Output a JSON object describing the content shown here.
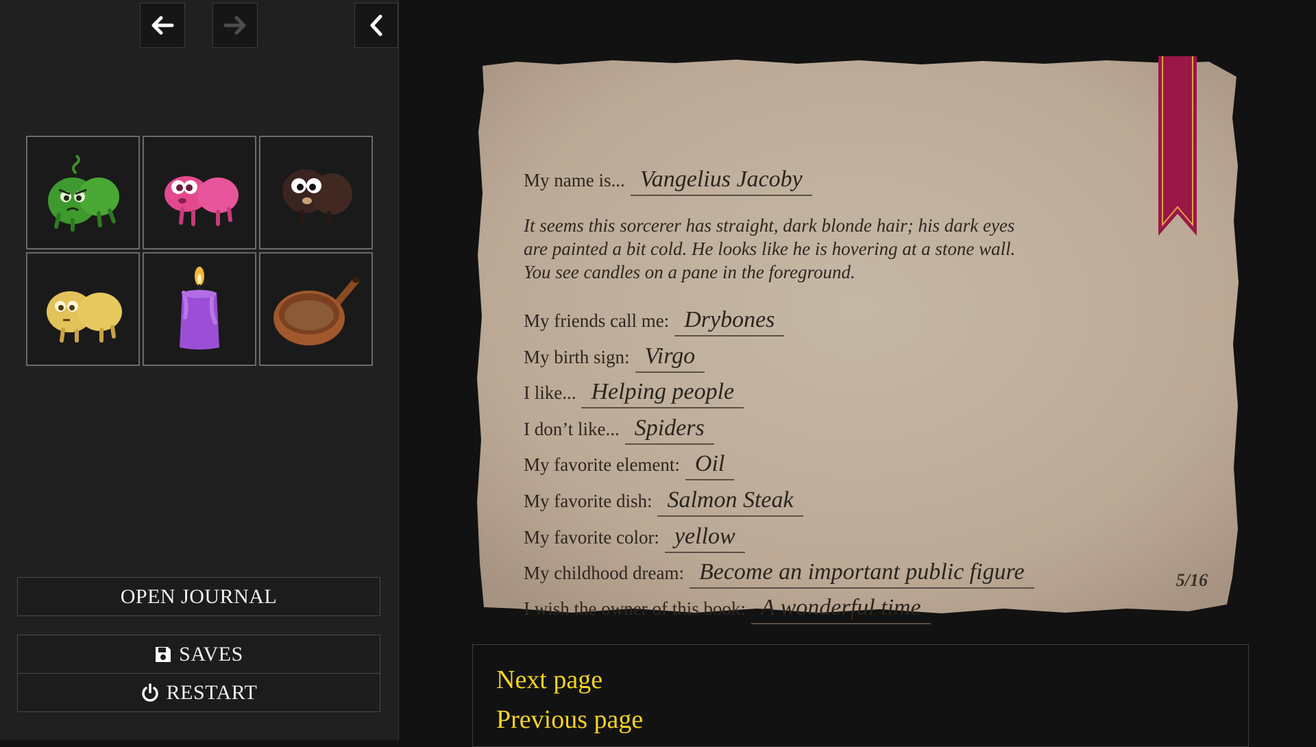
{
  "sidebar": {
    "nav": {
      "back_icon": "arrow-left-icon",
      "forward_icon": "arrow-right-icon",
      "collapse_icon": "chevron-left-icon"
    },
    "inventory": [
      {
        "item": "green-bean-creature-icon"
      },
      {
        "item": "pink-bean-creature-icon"
      },
      {
        "item": "black-bean-creature-icon"
      },
      {
        "item": "yellow-bean-creature-icon"
      },
      {
        "item": "purple-candle-icon"
      },
      {
        "item": "copper-pan-icon"
      }
    ],
    "open_journal_label": "OPEN JOURNAL",
    "saves_label": "SAVES",
    "restart_label": "RESTART"
  },
  "journal": {
    "name_label": "My name is...",
    "name_value": "Vangelius Jacoby",
    "description_lines": [
      "It seems this sorcerer has straight, dark blonde hair; his dark eyes",
      "are painted a bit cold. He looks like he is hovering at a stone wall.",
      "You see candles on a pane in the foreground."
    ],
    "fields": [
      {
        "label": "My friends call me:",
        "value": "Drybones"
      },
      {
        "label": "My birth sign:",
        "value": "Virgo"
      },
      {
        "label": "I like...",
        "value": "Helping people"
      },
      {
        "label": "I don’t like...",
        "value": "Spiders"
      },
      {
        "label": "My favorite element:",
        "value": "Oil"
      },
      {
        "label": "My favorite dish:",
        "value": "Salmon Steak"
      },
      {
        "label": "My favorite color:",
        "value": "yellow"
      },
      {
        "label": "My childhood dream:",
        "value": "Become an important public figure"
      },
      {
        "label": "I wish the owner of this book:",
        "value": "A wonderful time"
      }
    ],
    "page_indicator": "5/16"
  },
  "choices": {
    "next_label": "Next page",
    "previous_label": "Previous page"
  },
  "colors": {
    "choice_text": "#f5d421",
    "paper": "#c1b2a0",
    "bookmark": "#9a1746"
  }
}
